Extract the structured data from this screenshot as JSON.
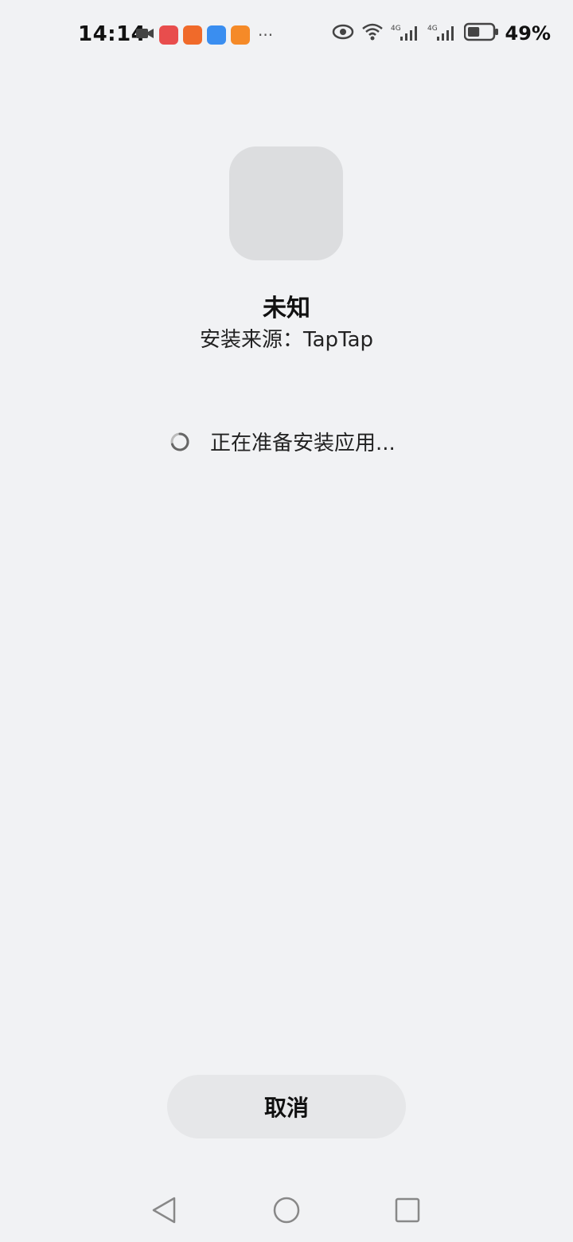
{
  "status_bar": {
    "time": "14:14",
    "battery_percent": "49%",
    "more_indicator": "···",
    "left_icons": [
      "video-camera-icon",
      "huawei-store-icon",
      "game-app-icon",
      "cloud-app-icon",
      "video-play-icon"
    ],
    "right_icons": [
      "eye-icon",
      "wifi-icon",
      "signal-4g-icon",
      "signal-4g-icon",
      "battery-icon"
    ],
    "battery_level": 0.49
  },
  "app": {
    "name": "未知",
    "install_source": "安装来源：TapTap"
  },
  "progress": {
    "message": "正在准备安装应用..."
  },
  "actions": {
    "cancel_label": "取消"
  },
  "nav": {
    "icons": [
      "back-icon",
      "home-icon",
      "recents-icon"
    ]
  },
  "colors": {
    "background": "#f1f2f4",
    "button_bg": "#e6e7e9",
    "placeholder": "#dcdddf"
  }
}
